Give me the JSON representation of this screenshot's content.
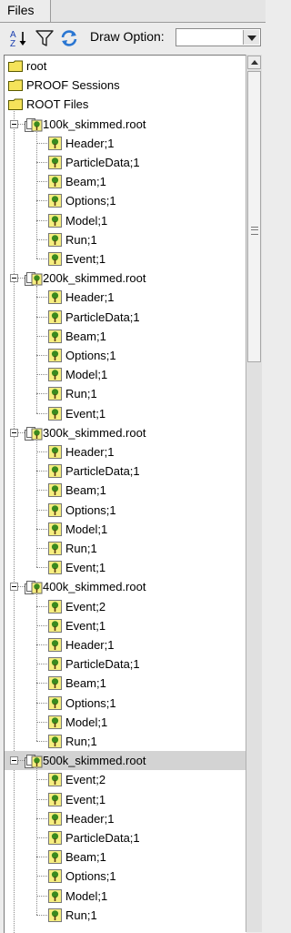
{
  "tab": {
    "label": "Files"
  },
  "toolbar": {
    "draw_option_label": "Draw Option:",
    "draw_option_value": "",
    "icons": [
      "sort-az-icon",
      "filter-icon",
      "refresh-icon"
    ]
  },
  "tree": {
    "top": [
      {
        "label": "root"
      },
      {
        "label": "PROOF Sessions"
      },
      {
        "label": "ROOT Files"
      }
    ],
    "files": [
      {
        "name": "100k_skimmed.root",
        "selected": false,
        "keys": [
          "Header;1",
          "ParticleData;1",
          "Beam;1",
          "Options;1",
          "Model;1",
          "Run;1",
          "Event;1"
        ]
      },
      {
        "name": "200k_skimmed.root",
        "selected": false,
        "keys": [
          "Header;1",
          "ParticleData;1",
          "Beam;1",
          "Options;1",
          "Model;1",
          "Run;1",
          "Event;1"
        ]
      },
      {
        "name": "300k_skimmed.root",
        "selected": false,
        "keys": [
          "Header;1",
          "ParticleData;1",
          "Beam;1",
          "Options;1",
          "Model;1",
          "Run;1",
          "Event;1"
        ]
      },
      {
        "name": "400k_skimmed.root",
        "selected": false,
        "keys": [
          "Event;2",
          "Event;1",
          "Header;1",
          "ParticleData;1",
          "Beam;1",
          "Options;1",
          "Model;1",
          "Run;1"
        ]
      },
      {
        "name": "500k_skimmed.root",
        "selected": true,
        "keys": [
          "Event;2",
          "Event;1",
          "Header;1",
          "ParticleData;1",
          "Beam;1",
          "Options;1",
          "Model;1",
          "Run;1"
        ]
      }
    ]
  },
  "colors": {
    "folder": "#f5e35a",
    "tree_leaf": "#3a8a1e",
    "selection": "#d3d3d3"
  }
}
